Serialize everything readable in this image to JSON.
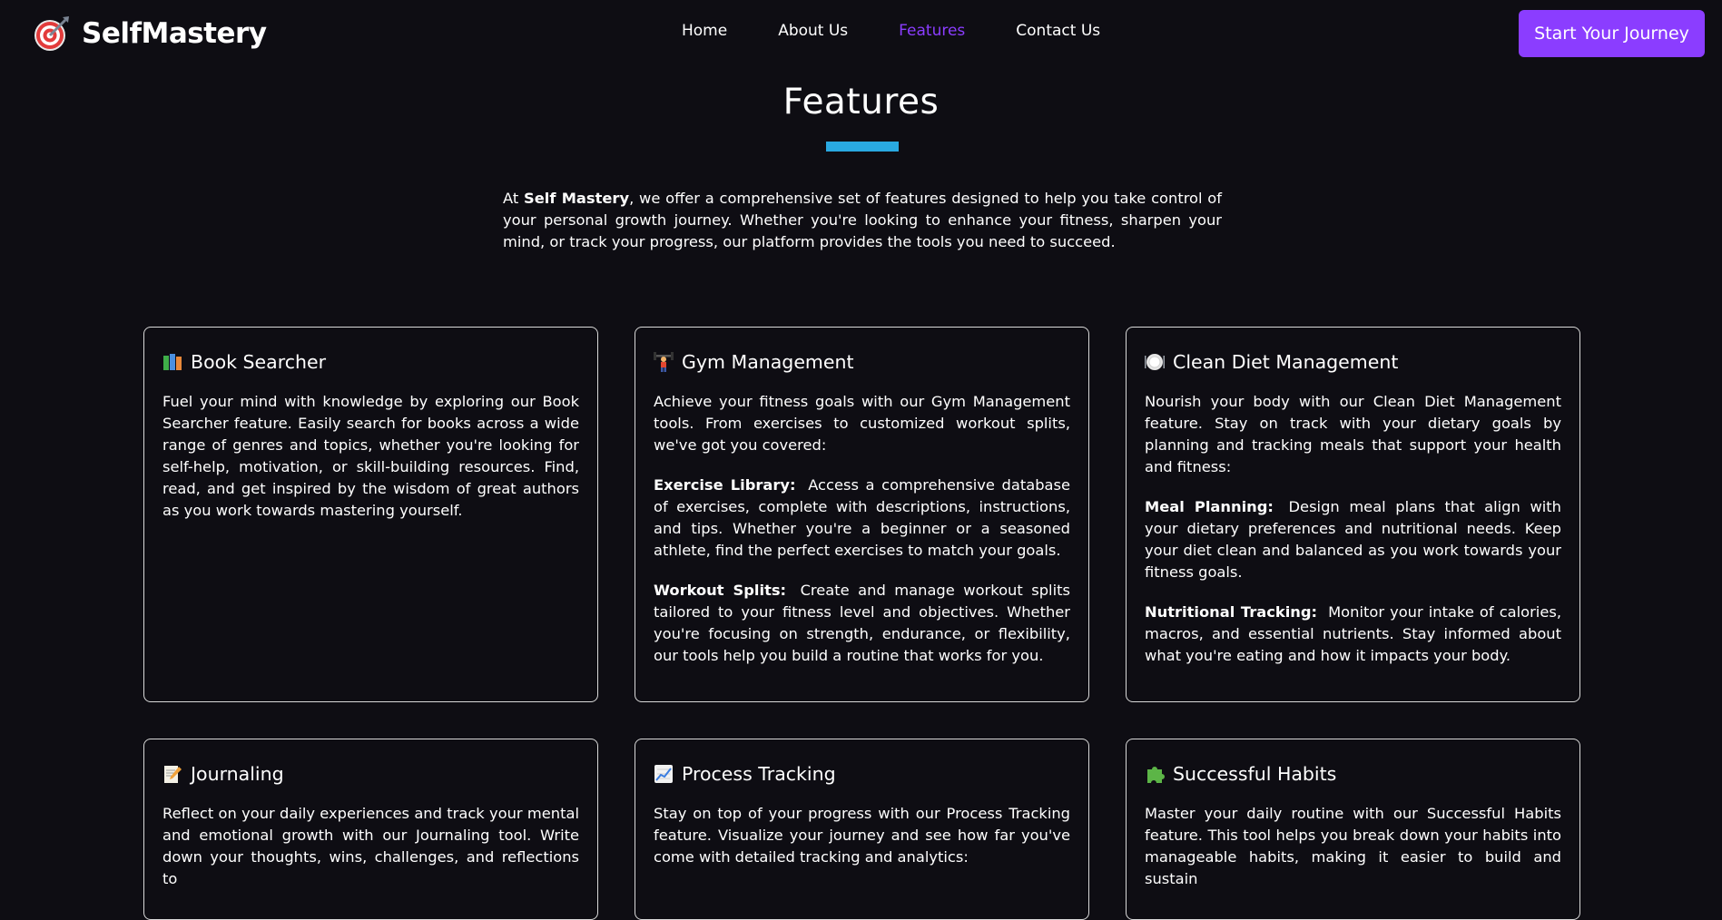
{
  "header": {
    "brand": "SelfMastery",
    "logo_icon": "dartboard-target-icon",
    "nav": [
      {
        "label": "Home",
        "active": false
      },
      {
        "label": "About Us",
        "active": false
      },
      {
        "label": "Features",
        "active": true
      },
      {
        "label": "Contact Us",
        "active": false
      }
    ],
    "cta_label": "Start Your Journey"
  },
  "colors": {
    "background": "#0e0d13",
    "accent": "#8b3dff",
    "underline": "#29a9e1",
    "card_border": "#d9d9d9"
  },
  "main": {
    "title": "Features",
    "intro_prefix": "At ",
    "intro_brand": "Self Mastery",
    "intro_rest": ", we offer a comprehensive set of features designed to help you take control of your personal growth journey. Whether you're looking to enhance your fitness, sharpen your mind, or track your progress, our platform provides the tools you need to succeed."
  },
  "cards": [
    {
      "icon": "books-icon",
      "title": "Book Searcher",
      "intro": "Fuel your mind with knowledge by exploring our Book Searcher feature. Easily search for books across a wide range of genres and topics, whether you're looking for self-help, motivation, or skill-building resources. Find, read, and get inspired by the wisdom of great authors as you work towards mastering yourself."
    },
    {
      "icon": "weightlifter-icon",
      "title": "Gym Management",
      "intro": "Achieve your fitness goals with our Gym Management tools. From exercises to customized workout splits, we've got you covered:",
      "items": [
        {
          "label": "Exercise Library:",
          "text": "Access a comprehensive database of exercises, complete with descriptions, instructions, and tips. Whether you're a beginner or a seasoned athlete, find the perfect exercises to match your goals."
        },
        {
          "label": "Workout Splits:",
          "text": "Create and manage workout splits tailored to your fitness level and objectives. Whether you're focusing on strength, endurance, or flexibility, our tools help you build a routine that works for you."
        }
      ]
    },
    {
      "icon": "plate-icon",
      "title": "Clean Diet Management",
      "intro": "Nourish your body with our Clean Diet Management feature. Stay on track with your dietary goals by planning and tracking meals that support your health and fitness:",
      "items": [
        {
          "label": "Meal Planning:",
          "text": "Design meal plans that align with your dietary preferences and nutritional needs. Keep your diet clean and balanced as you work towards your fitness goals."
        },
        {
          "label": "Nutritional Tracking:",
          "text": "Monitor your intake of calories, macros, and essential nutrients. Stay informed about what you're eating and how it impacts your body."
        }
      ]
    },
    {
      "icon": "memo-icon",
      "title": "Journaling",
      "intro": "Reflect on your daily experiences and track your mental and emotional growth with our Journaling tool. Write down your thoughts, wins, challenges, and reflections to"
    },
    {
      "icon": "chart-increasing-icon",
      "title": "Process Tracking",
      "intro": "Stay on top of your progress with our Process Tracking feature. Visualize your journey and see how far you've come with detailed tracking and analytics:"
    },
    {
      "icon": "puzzle-piece-icon",
      "title": "Successful Habits",
      "intro": "Master your daily routine with our Successful Habits feature. This tool helps you break down your habits into manageable habits, making it easier to build and sustain"
    }
  ]
}
